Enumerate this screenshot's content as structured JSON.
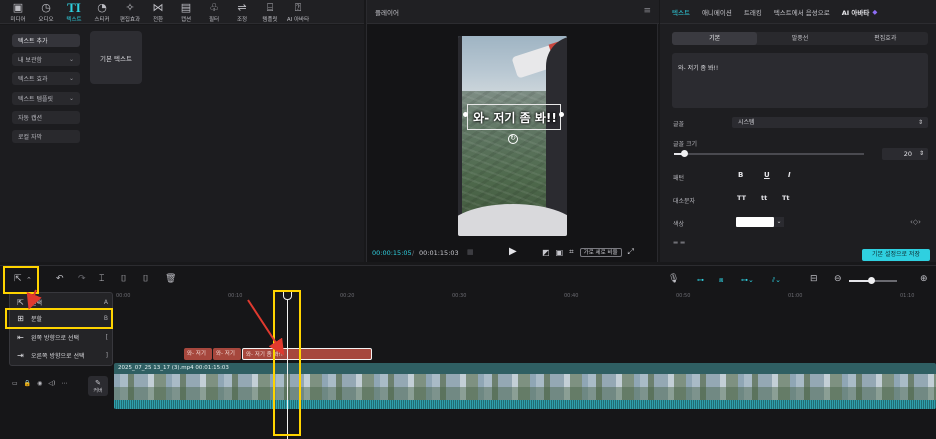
{
  "media_toolbar": {
    "tools": [
      {
        "label": "미디어",
        "icon": "media-icon"
      },
      {
        "label": "오디오",
        "icon": "audio-icon"
      },
      {
        "label": "텍스트",
        "icon": "text-icon"
      },
      {
        "label": "스티커",
        "icon": "sticker-icon"
      },
      {
        "label": "편집효과",
        "icon": "effects-icon"
      },
      {
        "label": "전환",
        "icon": "transition-icon"
      },
      {
        "label": "캡션",
        "icon": "caption-icon"
      },
      {
        "label": "필터",
        "icon": "filter-icon"
      },
      {
        "label": "조정",
        "icon": "adjust-icon"
      },
      {
        "label": "템플릿",
        "icon": "template-icon"
      },
      {
        "label": "AI 아바타",
        "icon": "ai-avatar-icon"
      }
    ],
    "active": "텍스트"
  },
  "left_nav": {
    "items": [
      {
        "label": "텍스트 추가",
        "has_chevron": false
      },
      {
        "label": "내 보관함",
        "has_chevron": true
      },
      {
        "label": "텍스트 효과",
        "has_chevron": true
      },
      {
        "label": "텍스트 템플릿",
        "has_chevron": true
      },
      {
        "label": "자동 캡션",
        "has_chevron": false
      },
      {
        "label": "로컬 자막",
        "has_chevron": false
      }
    ],
    "default_text_card": "기본 텍스트"
  },
  "player": {
    "title": "플레이어",
    "caption_text": "와- 저기 좀 봐!!",
    "current_time": "00:00:15:05",
    "total_time": "00:01:15:03",
    "ratio_label": "가로 세로 비율"
  },
  "inspector": {
    "tabs": [
      "텍스트",
      "애니메이션",
      "트래킹",
      "텍스트에서 음성으로",
      "AI 아바타"
    ],
    "active_tab": "텍스트",
    "sub_tabs": [
      "기본",
      "말풍선",
      "편집효과"
    ],
    "active_sub_tab": "기본",
    "text_value": "와- 저기 좀 봐!!",
    "font_label": "글꼴",
    "font_value": "시스템",
    "font_size_label": "글꼴 크기",
    "font_size_value": "20",
    "font_size_fraction": 0.05,
    "pattern_label": "패턴",
    "pattern_buttons": [
      "B",
      "U",
      "I"
    ],
    "case_label": "대소문자",
    "case_buttons": [
      "TT",
      "tt",
      "Tt"
    ],
    "color_label": "색상",
    "color_value": "#ffffff",
    "save_default_label": "기본 설정으로 저장"
  },
  "timeline": {
    "ruler_ticks": [
      "00:00",
      "00:10",
      "00:20",
      "00:30",
      "00:40",
      "00:50",
      "01:00",
      "01:10"
    ],
    "text_clips": [
      "와- 저기",
      "와- 저기",
      "와- 저기 좀 봐!!"
    ],
    "video_clip_label": "2025_07_25 13_17 (3).mp4  00:01:15:03",
    "cover_label": "커버"
  },
  "context_menu": {
    "items": [
      {
        "label": "선택",
        "key": "A",
        "icon": "cursor-icon"
      },
      {
        "label": "분할",
        "key": "B",
        "icon": "split-icon"
      },
      {
        "label": "왼쪽 방향으로 선택",
        "key": "[",
        "icon": "select-left-icon"
      },
      {
        "label": "오른쪽 방향으로 선택",
        "key": "]",
        "icon": "select-right-icon"
      }
    ]
  },
  "colors": {
    "accent": "#2fd0e0",
    "clip": "#a6473d",
    "highlight": "#ffd400",
    "arrow": "#e03a2f"
  }
}
